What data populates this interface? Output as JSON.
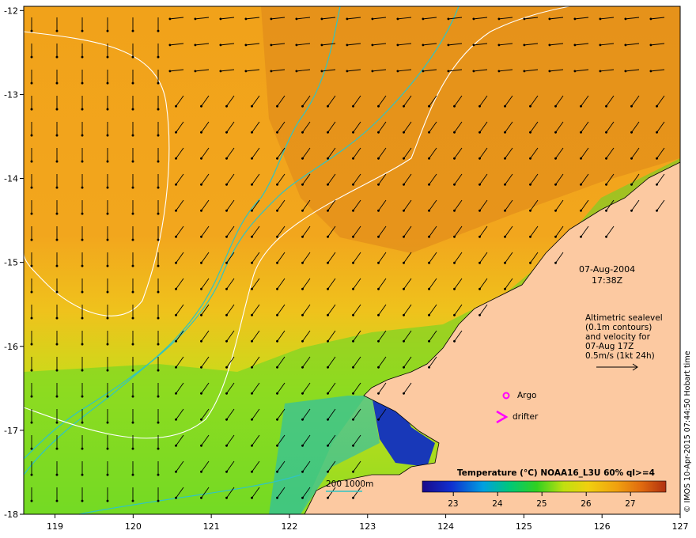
{
  "map": {
    "x_axis_ticks": [
      "119",
      "120",
      "121",
      "122",
      "123",
      "124",
      "125",
      "126",
      "127"
    ],
    "y_axis_ticks": [
      "-12",
      "-13",
      "-14",
      "-15",
      "-16",
      "-17",
      "-18"
    ],
    "lon_range": [
      118.6,
      127.0
    ],
    "lat_range": [
      -18.0,
      -11.95
    ]
  },
  "annotations": {
    "date": "07-Aug-2004",
    "time": "17:38Z",
    "altimetric_lines": [
      "Altimetric sealevel",
      "(0.1m contours)",
      "and velocity for",
      "07-Aug 17Z",
      "0.5m/s (1kt 24h)"
    ],
    "argo_label": "Argo",
    "drifter_label": "drifter",
    "depth_legend": "200  1000m",
    "credit": "© IMOS 10-Apr-2015 07:44:50 Hobart time"
  },
  "colorbar": {
    "title": "Temperature (°C) NOAA16_L3U 60% ql>=4",
    "ticks": [
      "23",
      "24",
      "25",
      "26",
      "27"
    ],
    "range": [
      22.3,
      27.8
    ]
  },
  "colors": {
    "land": "#fcc9a1",
    "depth_contour": "#2fc4c4",
    "sealevel_contour": "#ffffff",
    "argo_marker": "#ff00ff",
    "drifter_marker": "#ff00ff"
  }
}
